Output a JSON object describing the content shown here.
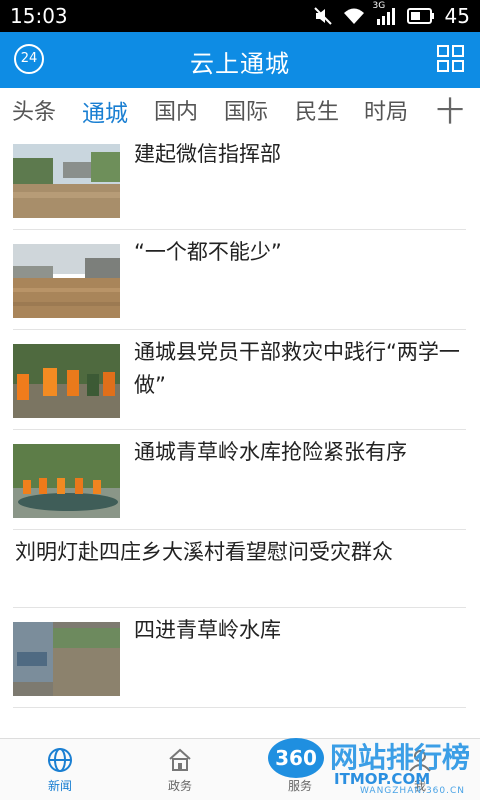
{
  "status_bar": {
    "time": "15:03",
    "battery": "45",
    "network": "3G"
  },
  "header": {
    "title": "云上通城",
    "weather_badge": "24",
    "menu_icon": "grid-icon"
  },
  "tabs": [
    {
      "label": "头条",
      "active": false
    },
    {
      "label": "通城",
      "active": true
    },
    {
      "label": "国内",
      "active": false
    },
    {
      "label": "国际",
      "active": false
    },
    {
      "label": "民生",
      "active": false
    },
    {
      "label": "时局",
      "active": false
    }
  ],
  "tab_add": "十",
  "news": [
    {
      "title": "建起微信指挥部",
      "has_image": true
    },
    {
      "title": "“一个都不能少”",
      "has_image": true
    },
    {
      "title": "通城县党员干部救灾中践行“两学一做”",
      "has_image": true
    },
    {
      "title": " 通城青草岭水库抢险紧张有序",
      "has_image": true
    },
    {
      "title": "刘明灯赴四庄乡大溪村看望慰问受灾群众",
      "has_image": false
    },
    {
      "title": "四进青草岭水库",
      "has_image": true
    }
  ],
  "bottom_nav": [
    {
      "label": "新闻",
      "icon": "globe-icon",
      "active": true
    },
    {
      "label": "政务",
      "icon": "government-icon",
      "active": false
    },
    {
      "label": "服务",
      "icon": "service-icon",
      "active": false
    },
    {
      "label": "我",
      "icon": "user-icon",
      "active": false
    }
  ],
  "watermark": {
    "badge": "360",
    "title": "网站排行榜",
    "brand": "ITMOP.COM",
    "url": "WANGZHAN.360.CN"
  },
  "colors": {
    "header": "#0e8ce4",
    "active_tab": "#1a7fd2"
  }
}
